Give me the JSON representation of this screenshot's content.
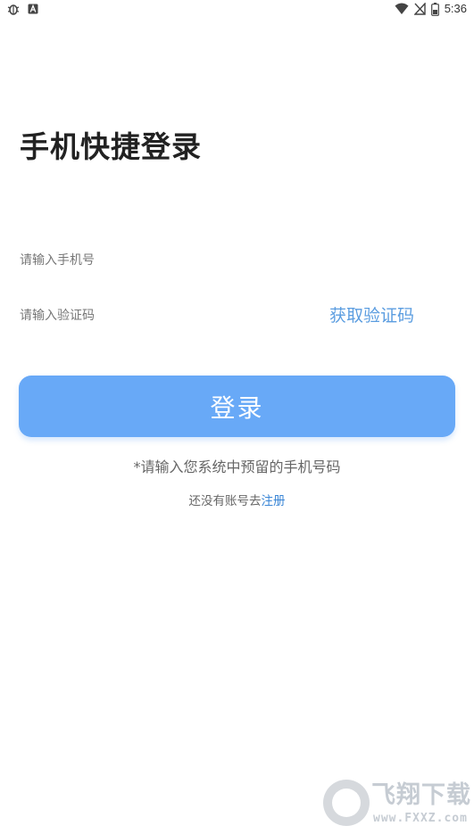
{
  "status_bar": {
    "time": "5:36",
    "left_icons": [
      "bug-icon",
      "a-notification-icon"
    ],
    "right_icons": [
      "wifi-icon",
      "no-sim-icon",
      "battery-icon"
    ]
  },
  "login": {
    "title": "手机快捷登录",
    "phone_placeholder": "请输入手机号",
    "code_placeholder": "请输入验证码",
    "get_code_label": "获取验证码",
    "login_label": "登录",
    "hint": "*请输入您系统中预留的手机号码",
    "register_prefix": "还没有账号去",
    "register_link": "注册"
  },
  "watermark": {
    "title": "飞翔下载",
    "domain": "www.FXXZ.com"
  },
  "colors": {
    "accent": "#68a9f7",
    "link": "#3a86d6",
    "get_code": "#5b9de0"
  }
}
